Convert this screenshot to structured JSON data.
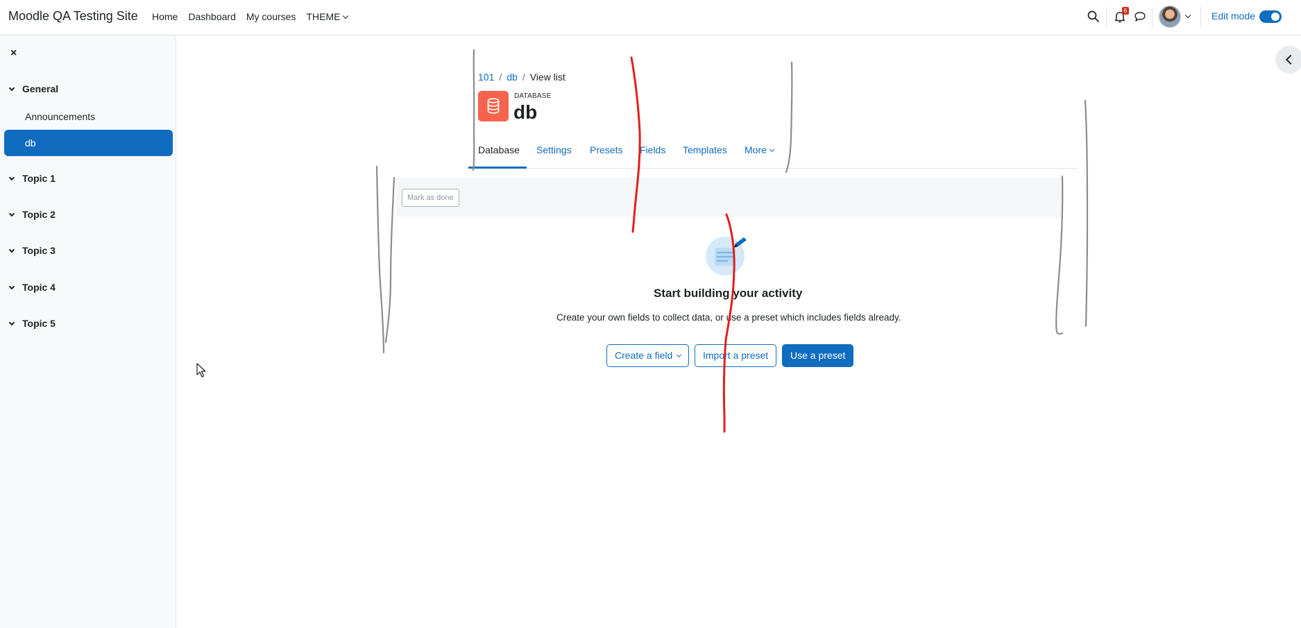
{
  "navbar": {
    "site_name": "Moodle QA Testing Site",
    "links": [
      "Home",
      "Dashboard",
      "My courses"
    ],
    "theme_menu": "THEME",
    "notification_count": "6",
    "edit_mode_label": "Edit mode",
    "edit_mode_on": true
  },
  "course_index": {
    "close_label": "×",
    "sections": [
      {
        "title": "General",
        "activities": [
          "Announcements",
          "db"
        ]
      },
      {
        "title": "Topic 1"
      },
      {
        "title": "Topic 2"
      },
      {
        "title": "Topic 3"
      },
      {
        "title": "Topic 4"
      },
      {
        "title": "Topic 5"
      }
    ],
    "active_activity": "db"
  },
  "breadcrumb": [
    "101",
    "db",
    "View list"
  ],
  "activity": {
    "type_label": "DATABASE",
    "title": "db"
  },
  "secondary_nav": {
    "tabs": [
      "Database",
      "Settings",
      "Presets",
      "Fields",
      "Templates",
      "More"
    ],
    "active_tab": "Database"
  },
  "completion": {
    "mark_as_done": "Mark as done"
  },
  "empty_state": {
    "title": "Start building your activity",
    "description": "Create your own fields to collect data, or use a preset which includes fields already.",
    "buttons": {
      "create_field": "Create a field",
      "import_preset": "Import a preset",
      "use_preset": "Use a preset"
    }
  },
  "colors": {
    "brand": "#0f6cbf",
    "activity_icon_bg": "#f7634d",
    "annotation_red": "#e0201b",
    "annotation_gray": "#8c8c8c"
  }
}
